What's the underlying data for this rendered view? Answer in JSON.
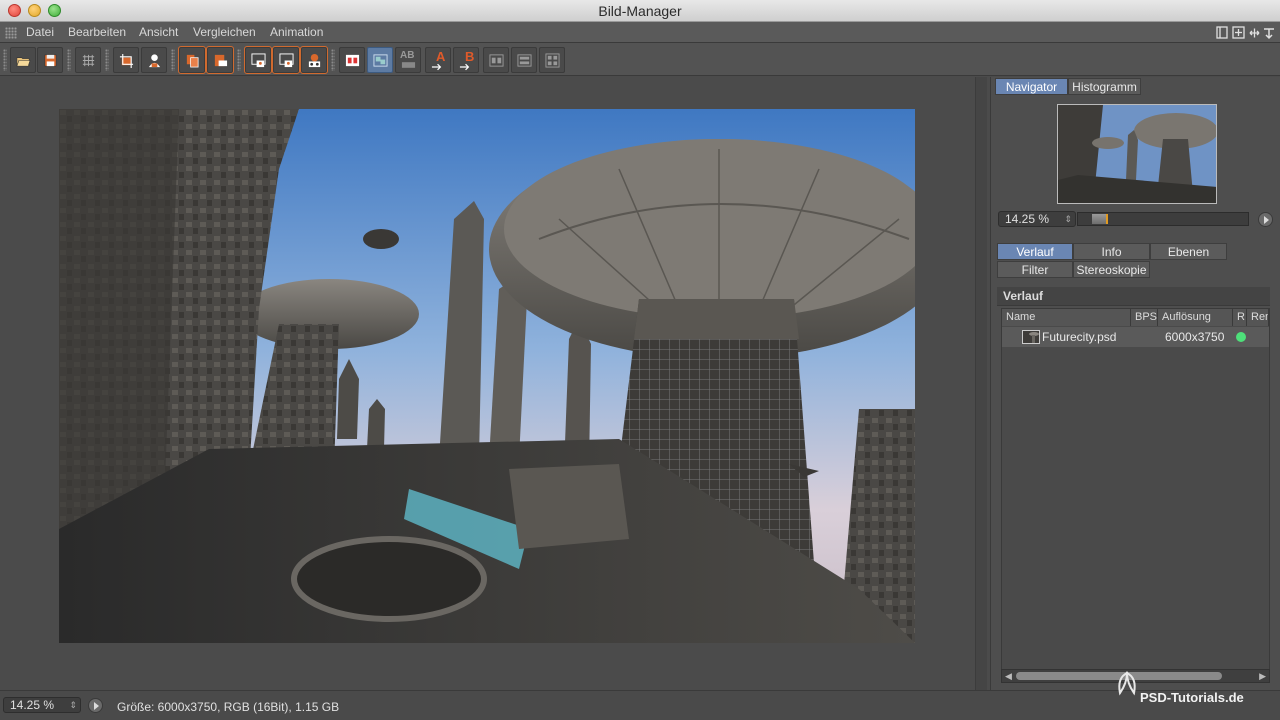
{
  "window": {
    "title": "Bild-Manager"
  },
  "menu": {
    "items": [
      "Datei",
      "Bearbeiten",
      "Ansicht",
      "Vergleichen",
      "Animation"
    ]
  },
  "toolbar": {
    "buttons": [
      {
        "name": "open-icon"
      },
      {
        "name": "save-icon"
      },
      {
        "name": "grid-icon"
      },
      {
        "name": "crop-icon"
      },
      {
        "name": "user-icon"
      },
      {
        "name": "copy-icon"
      },
      {
        "name": "paste-icon"
      },
      {
        "name": "view-a-icon"
      },
      {
        "name": "view-b-icon"
      },
      {
        "name": "view-stereo-icon"
      },
      {
        "name": "ab-split-icon"
      },
      {
        "name": "ab-compare-icon"
      },
      {
        "name": "ab-text-icon"
      },
      {
        "name": "set-a-icon"
      },
      {
        "name": "set-b-icon"
      },
      {
        "name": "layer-1-icon"
      },
      {
        "name": "layer-2-icon"
      },
      {
        "name": "layer-3-icon"
      }
    ],
    "letter_a": "A",
    "letter_b": "B",
    "ab_text": "AB"
  },
  "navigator": {
    "tabs": [
      "Navigator",
      "Histogramm"
    ],
    "active_tab": "Navigator",
    "zoom": "14.25 %",
    "zoom_level": 0.09
  },
  "history": {
    "tabs_row1": [
      "Verlauf",
      "Info",
      "Ebenen"
    ],
    "tabs_row2": [
      "Filter",
      "Stereoskopie"
    ],
    "active_tab": "Verlauf",
    "section_title": "Verlauf",
    "columns": [
      "Name",
      "BPS",
      "Auflösung",
      "R",
      "Ren"
    ],
    "rows": [
      {
        "name": "Futurecity.psd",
        "bps": "",
        "resolution": "6000x3750",
        "status_color": "#4ee07a"
      }
    ]
  },
  "status": {
    "zoom": "14.25 %",
    "info": "Größe: 6000x3750, RGB (16Bit), 1.15 GB"
  },
  "watermark": {
    "text": "PSD-Tutorials.de"
  },
  "colors": {
    "accent": "#6a86b3",
    "orange": "#d06a2f",
    "status_green": "#4ee07a"
  }
}
